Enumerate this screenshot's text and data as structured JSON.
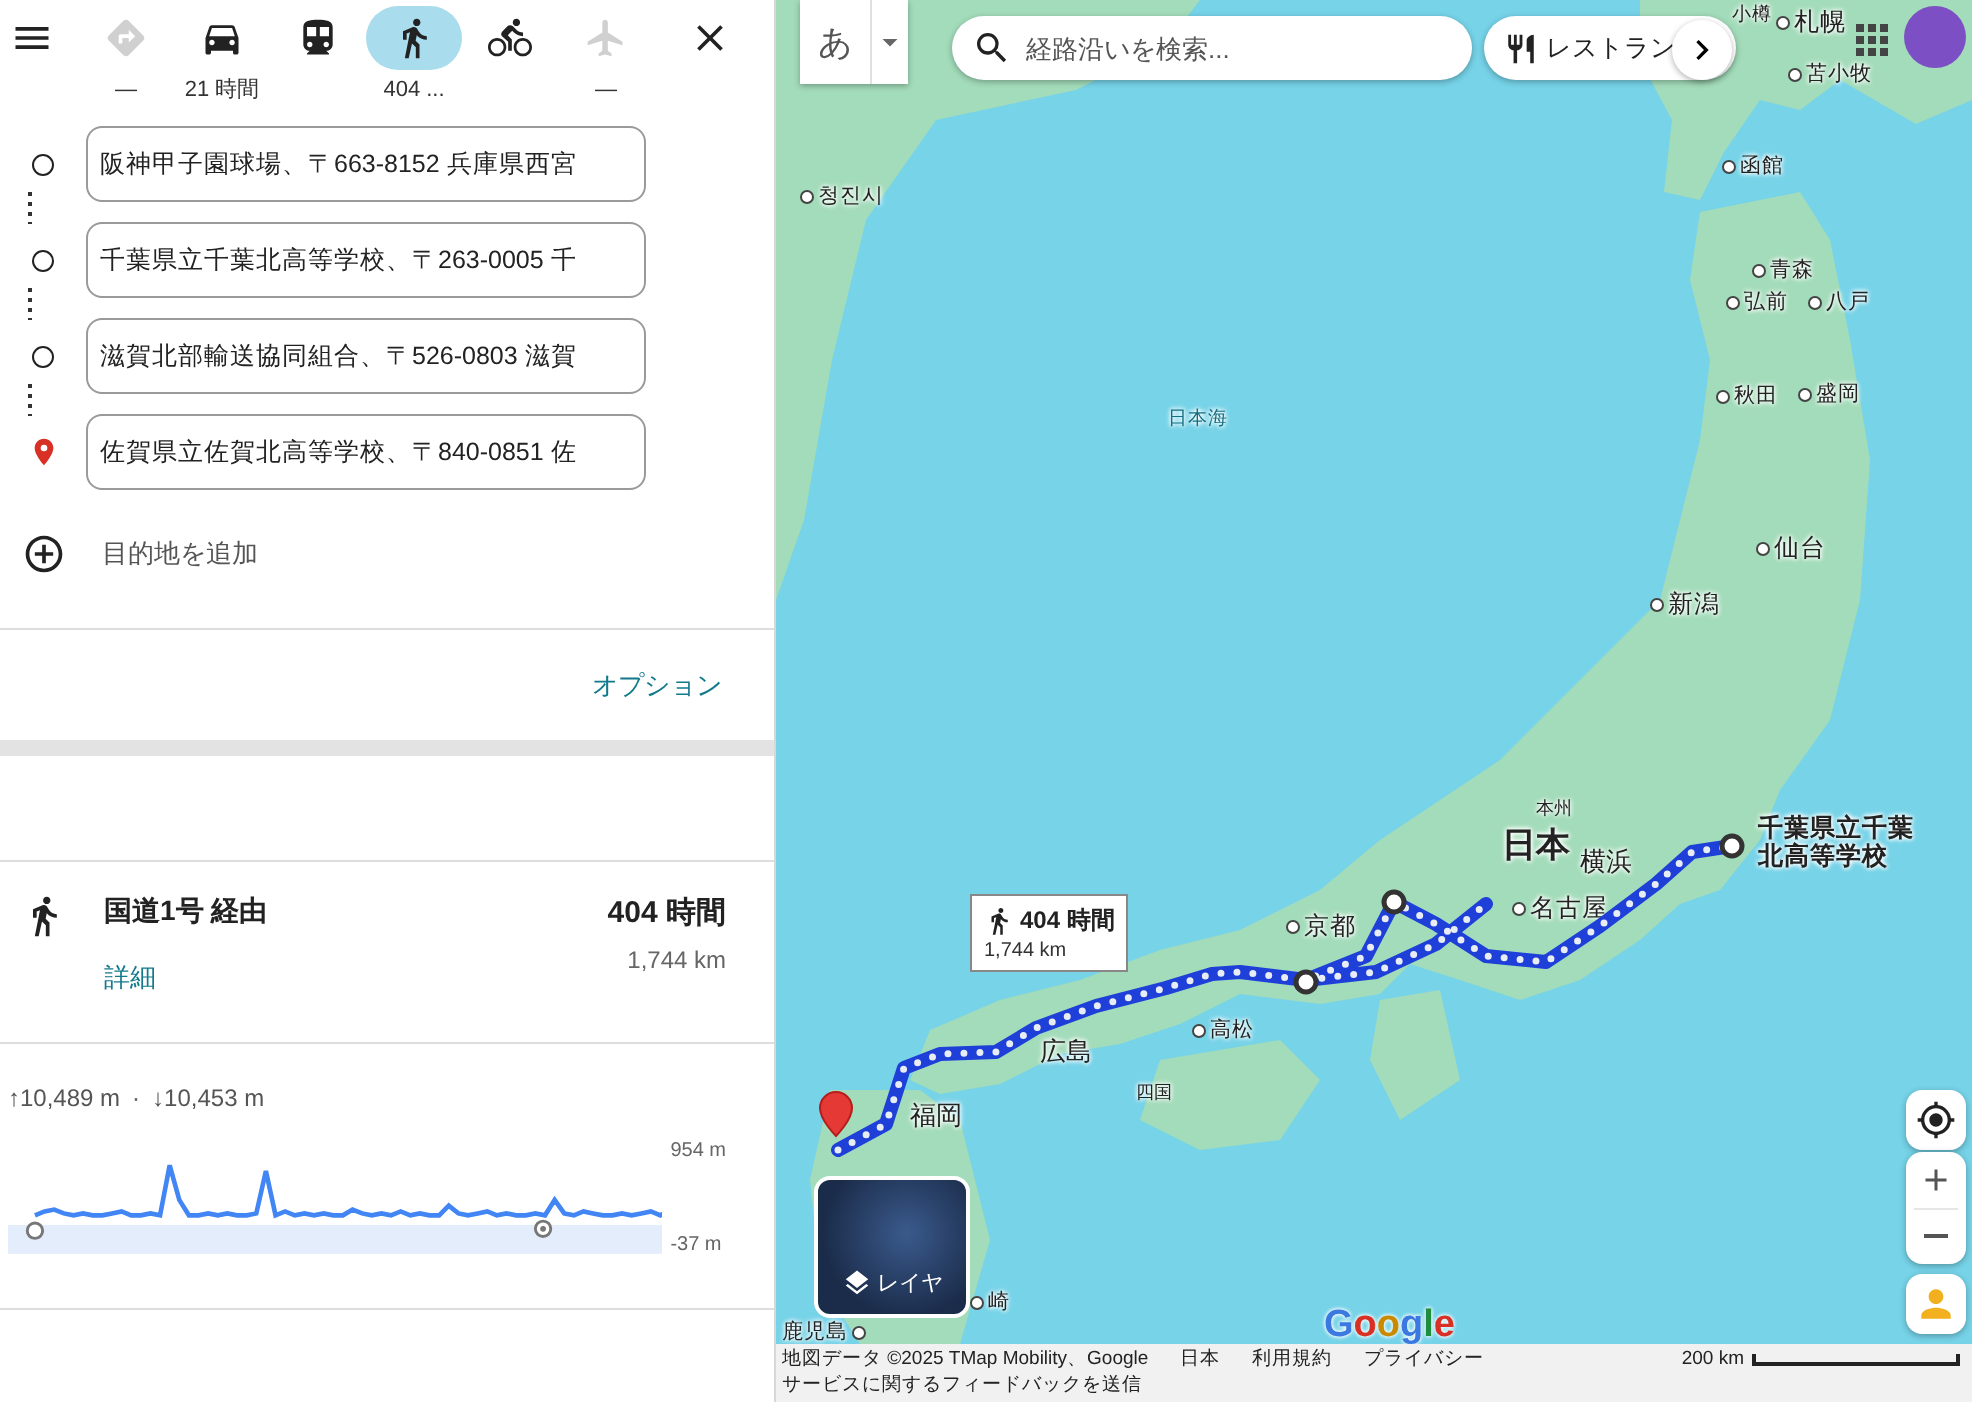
{
  "travel_modes": [
    {
      "kind": "best",
      "label": "—",
      "selected": false,
      "disabled": true
    },
    {
      "kind": "car",
      "label": "21 時間",
      "selected": false,
      "disabled": false
    },
    {
      "kind": "transit",
      "selected": false,
      "disabled": false
    },
    {
      "kind": "walk",
      "label": "404 ...",
      "selected": true,
      "disabled": false
    },
    {
      "kind": "bicycle",
      "selected": false,
      "disabled": false
    },
    {
      "kind": "flight",
      "label": "—",
      "selected": false,
      "disabled": true
    }
  ],
  "waypoints": [
    {
      "kind": "stop",
      "value": "阪神甲子園球場、〒663-8152 兵庫県西宮"
    },
    {
      "kind": "stop",
      "value": "千葉県立千葉北高等学校、〒263-0005 千"
    },
    {
      "kind": "stop",
      "value": "滋賀北部輸送協同組合、〒526-0803 滋賀"
    },
    {
      "kind": "destination",
      "value": "佐賀県立佐賀北高等学校、〒840-0851 佐"
    }
  ],
  "add_destination": "目的地を追加",
  "options_link": "オプション",
  "route": {
    "name": "国道1号 経由",
    "duration": "404 時間",
    "distance": "1,744 km",
    "details_link": "詳細"
  },
  "elevation": {
    "ascent": "↑10,489 m",
    "separator": "·",
    "descent": "↓10,453 m",
    "max": "954 m",
    "min": "-37 m"
  },
  "map": {
    "input_method": "あ",
    "search": {
      "placeholder": "経路沿いを検索..."
    },
    "category_chip": "レストラン",
    "places": [
      {
        "kind": "tiny_city",
        "name": "小樽"
      },
      {
        "kind": "major_city",
        "name": "札幌"
      },
      {
        "kind": "city",
        "name": "苫小牧"
      },
      {
        "kind": "city",
        "name": "函館"
      },
      {
        "kind": "city",
        "name": "청진시"
      },
      {
        "kind": "sea",
        "name": "日本海"
      },
      {
        "kind": "city",
        "name": "青森"
      },
      {
        "kind": "city",
        "name": "弘前"
      },
      {
        "kind": "city",
        "name": "八戸"
      },
      {
        "kind": "city",
        "name": "秋田"
      },
      {
        "kind": "city",
        "name": "盛岡"
      },
      {
        "kind": "major_city",
        "name": "仙台"
      },
      {
        "kind": "major_city",
        "name": "新潟"
      },
      {
        "kind": "subregion",
        "name": "本州"
      },
      {
        "kind": "region",
        "name": "日本"
      },
      {
        "kind": "major_label",
        "name": "横浜"
      },
      {
        "kind": "destination",
        "name": "千葉県立千葉北高等学校"
      },
      {
        "kind": "major_city",
        "name": "名古屋"
      },
      {
        "kind": "major_city",
        "name": "京都"
      },
      {
        "kind": "major_label",
        "name": "広島"
      },
      {
        "kind": "city",
        "name": "高松"
      },
      {
        "kind": "subregion",
        "name": "四国"
      },
      {
        "kind": "major_label",
        "name": "福岡"
      },
      {
        "kind": "city",
        "name": "崎"
      },
      {
        "kind": "city_after",
        "name": "鹿児島"
      }
    ],
    "route_callout": {
      "duration": "404 時間",
      "distance": "1,744 km"
    },
    "layers_button": "レイヤ",
    "logo": "Google",
    "attribution": [
      "地図データ ©2025 TMap Mobility、Google",
      "日本",
      "利用規約",
      "プライバシー"
    ],
    "scale": "200 km",
    "feedback_link": "サービスに関するフィードバックを送信"
  }
}
